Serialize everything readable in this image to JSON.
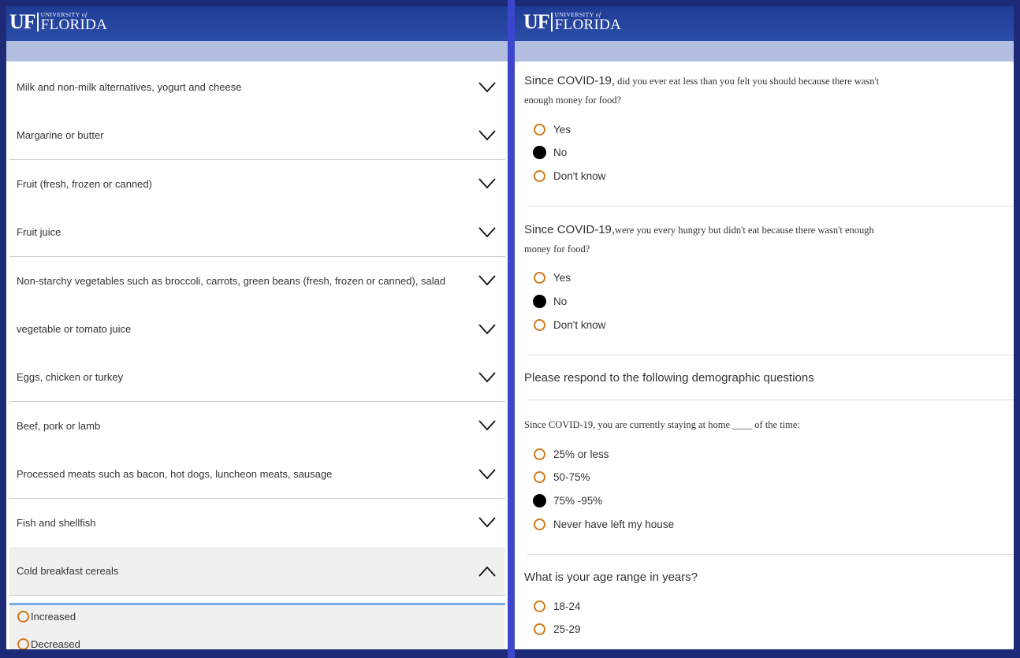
{
  "logo": {
    "short": "UF",
    "university": "UNIVERSITY",
    "of": "of",
    "name": "FLORIDA"
  },
  "left": {
    "items": [
      {
        "label": "Milk and non-milk alternatives, yogurt and cheese"
      },
      {
        "label": "Margarine or butter"
      },
      {
        "label": "Fruit (fresh, frozen or canned)"
      },
      {
        "label": "Fruit juice"
      },
      {
        "label": "Non-starchy vegetables such as broccoli, carrots, green beans (fresh, frozen or canned), salad"
      },
      {
        "label": "vegetable or tomato juice"
      },
      {
        "label": "Eggs, chicken or turkey"
      },
      {
        "label": "Beef, pork or lamb"
      },
      {
        "label": "Processed meats such as bacon, hot dogs, luncheon meats, sausage"
      },
      {
        "label": "Fish and shellfish"
      },
      {
        "label": "Cold breakfast cereals",
        "expanded": true
      }
    ],
    "expanded_options": [
      "Increased",
      "Decreased"
    ]
  },
  "right": {
    "q1": {
      "prefix": "Since COVID-19,",
      "line1": " did you ever eat less than you felt you should because there wasn't",
      "line2": "enough money for food?",
      "options": [
        "Yes",
        "No",
        "Don't know"
      ],
      "selected": "No"
    },
    "q2": {
      "prefix": "Since COVID-19,",
      "line1": "were you every hungry but didn't eat because there wasn't enough",
      "line2": "money for food?",
      "options": [
        "Yes",
        "No",
        "Don't know"
      ],
      "selected": "No"
    },
    "section_heading": "Please respond to the following demographic questions",
    "q3": {
      "text": "Since COVID-19, you are currently staying at home ____ of the time:",
      "options": [
        "25% or less",
        "50-75%",
        "75% -95%",
        "Never have left my house"
      ],
      "selected": "75% -95%"
    },
    "q4": {
      "text": "What is your age range in years?",
      "options": [
        "18-24",
        "25-29"
      ]
    }
  },
  "colors": {
    "radio_ring": "#d27a1a",
    "accent_blue": "#78aee8",
    "header_blue": "#1f3c95"
  }
}
